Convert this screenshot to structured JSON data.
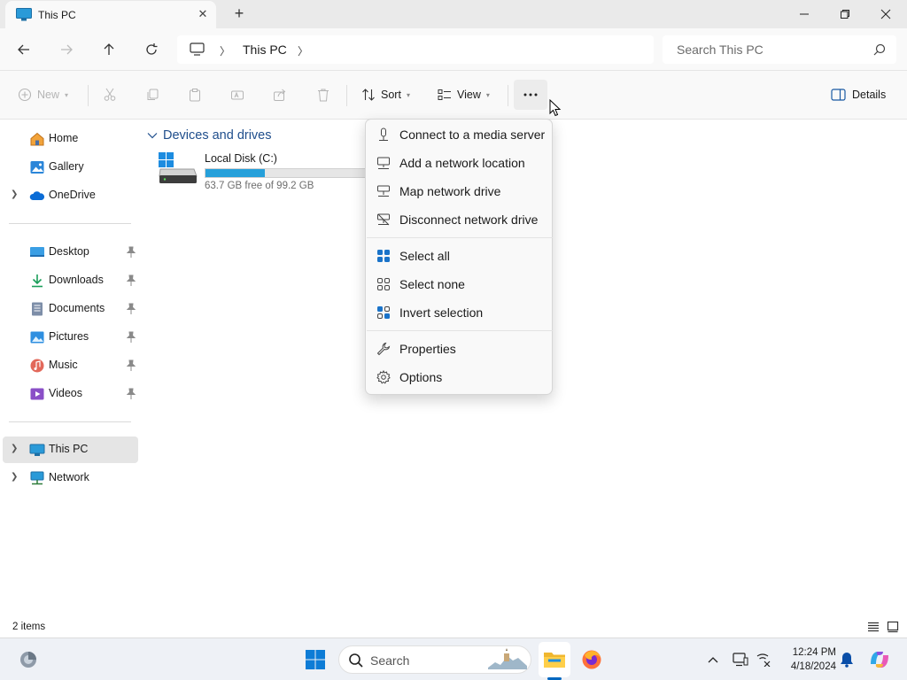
{
  "window": {
    "tab_title": "This PC",
    "new_tab": "+"
  },
  "address": {
    "crumb": "This PC",
    "search_placeholder": "Search This PC"
  },
  "commands": {
    "new": "New",
    "sort": "Sort",
    "view": "View",
    "details": "Details"
  },
  "sidebar": {
    "top": [
      {
        "label": "Home",
        "icon": "home-icon"
      },
      {
        "label": "Gallery",
        "icon": "gallery-icon"
      },
      {
        "label": "OneDrive",
        "icon": "onedrive-icon"
      }
    ],
    "quick": [
      {
        "label": "Desktop",
        "icon": "desktop-icon"
      },
      {
        "label": "Downloads",
        "icon": "downloads-icon"
      },
      {
        "label": "Documents",
        "icon": "documents-icon"
      },
      {
        "label": "Pictures",
        "icon": "pictures-icon"
      },
      {
        "label": "Music",
        "icon": "music-icon"
      },
      {
        "label": "Videos",
        "icon": "videos-icon"
      }
    ],
    "bottom": [
      {
        "label": "This PC",
        "icon": "this-pc-icon",
        "selected": true
      },
      {
        "label": "Network",
        "icon": "network-icon"
      }
    ]
  },
  "content": {
    "group_title": "Devices and drives",
    "drive": {
      "name": "Local Disk (C:)",
      "free_text": "63.7 GB free of 99.2 GB",
      "used_fraction": 0.358
    }
  },
  "menu": {
    "items": [
      "Connect to a media server",
      "Add a network location",
      "Map network drive",
      "Disconnect network drive",
      "Select all",
      "Select none",
      "Invert selection",
      "Properties",
      "Options"
    ]
  },
  "status": {
    "count": "2 items"
  },
  "taskbar": {
    "search_label": "Search",
    "time": "12:24 PM",
    "date": "4/18/2024"
  },
  "colors": {
    "accent": "#0067c0",
    "drive_bar": "#26a0da",
    "group_header": "#1f4e8c"
  }
}
